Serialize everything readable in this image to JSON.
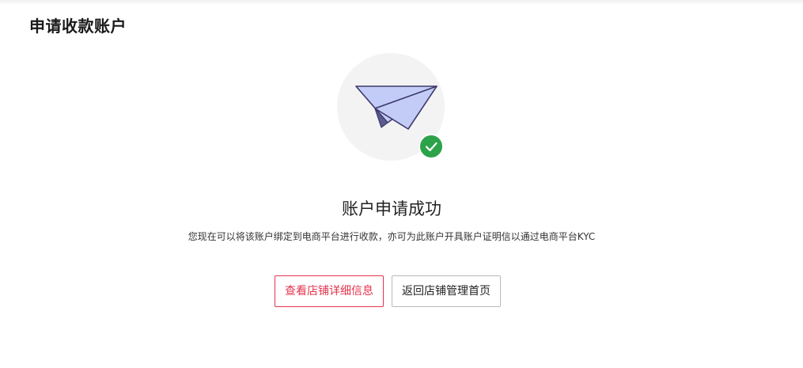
{
  "header": {
    "title": "申请收款账户"
  },
  "illustration": {
    "main_icon": "paper-plane-icon",
    "badge_icon": "check-circle-icon",
    "badge_color": "#2ca24a",
    "plane_color": "#c3ccf7",
    "plane_stroke": "#3d3a6b"
  },
  "result": {
    "title": "账户申请成功",
    "description": "您现在可以将该账户绑定到电商平台进行收款，亦可为此账户开具账户证明信以通过电商平台KYC"
  },
  "actions": {
    "view_details_label": "查看店铺详细信息",
    "back_home_label": "返回店铺管理首页"
  },
  "colors": {
    "accent": "#e5334d",
    "success": "#2ca24a"
  }
}
